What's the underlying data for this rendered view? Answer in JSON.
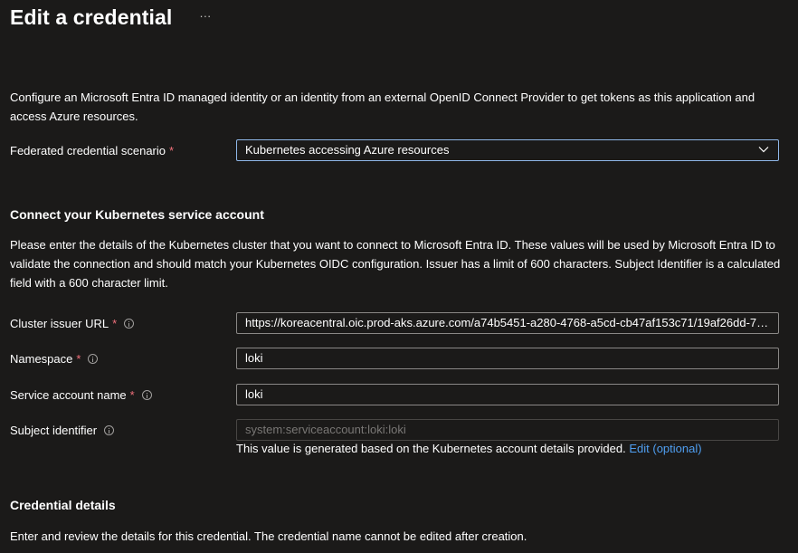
{
  "header": {
    "title": "Edit a credential",
    "more_label": "···"
  },
  "intro": {
    "text": "Configure an Microsoft Entra ID managed identity or an identity from an external OpenID Connect Provider to get tokens as this application and access Azure resources."
  },
  "scenario": {
    "label": "Federated credential scenario",
    "required_mark": "*",
    "selected": "Kubernetes accessing Azure resources"
  },
  "connect_section": {
    "heading": "Connect your Kubernetes service account",
    "description": "Please enter the details of the Kubernetes cluster that you want to connect to Microsoft Entra ID. These values will be used by Microsoft Entra ID to validate the connection and should match your Kubernetes OIDC configuration. Issuer has a limit of 600 characters. Subject Identifier is a calculated field with a 600 character limit."
  },
  "fields": {
    "cluster_issuer": {
      "label": "Cluster issuer URL",
      "required_mark": "*",
      "value": "https://koreacentral.oic.prod-aks.azure.com/a74b5451-a280-4768-a5cd-cb47af153c71/19af26dd-78..."
    },
    "namespace": {
      "label": "Namespace",
      "required_mark": "*",
      "value": "loki"
    },
    "service_account": {
      "label": "Service account name",
      "required_mark": "*",
      "value": "loki"
    },
    "subject_identifier": {
      "label": "Subject identifier",
      "placeholder": "system:serviceaccount:loki:loki",
      "helper_text": "This value is generated based on the Kubernetes account details provided.",
      "edit_link": "Edit (optional)"
    }
  },
  "credential_section": {
    "heading": "Credential details",
    "description": "Enter and review the details for this credential. The credential name cannot be edited after creation."
  },
  "colors": {
    "background": "#1b1a19",
    "required": "#f1707b",
    "link": "#4f9ef0",
    "focus_border": "#8fb7e8"
  }
}
